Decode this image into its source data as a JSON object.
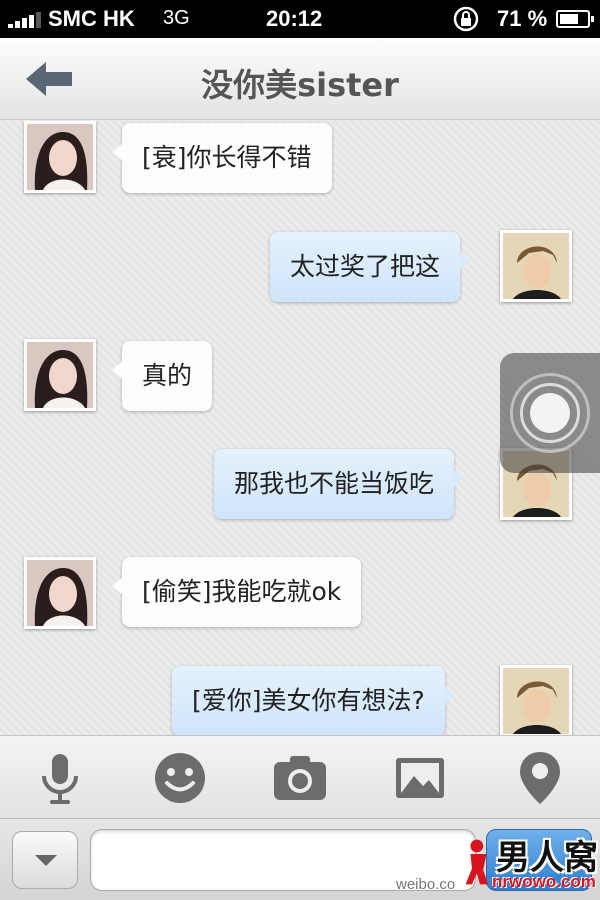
{
  "status_bar": {
    "carrier": "SMC HK",
    "network": "3G",
    "time": "20:12",
    "battery_percent": "71 %",
    "battery_level": 0.71
  },
  "nav": {
    "title": "没你美sister",
    "back_icon": "back-arrow-icon"
  },
  "messages": [
    {
      "side": "left",
      "text": "[衰]你长得不错"
    },
    {
      "side": "right",
      "text": "太过奖了把这"
    },
    {
      "side": "left",
      "text": "真的"
    },
    {
      "side": "right",
      "text": "那我也不能当饭吃"
    },
    {
      "side": "left",
      "text": "[偷笑]我能吃就ok"
    },
    {
      "side": "right",
      "text": "[爱你]美女你有想法?"
    }
  ],
  "toolbar": {
    "icons": [
      "microphone-icon",
      "emoji-icon",
      "camera-icon",
      "photo-gallery-icon",
      "location-pin-icon"
    ]
  },
  "input": {
    "value": "",
    "placeholder": ""
  },
  "watermark": {
    "weibo": "weibo.co",
    "logo": "男人窝",
    "logo_sub": "nrwowo.com"
  },
  "colors": {
    "incoming_bubble": "#fdfdfd",
    "outgoing_bubble": "#d8eafc",
    "send_button": "#3d86d4"
  }
}
